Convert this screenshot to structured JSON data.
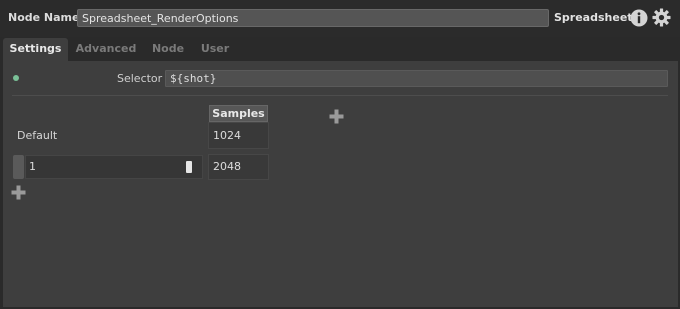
{
  "header": {
    "node_name_label": "Node Name",
    "node_name_value": "Spreadsheet_RenderOptions",
    "node_type": "Spreadsheet",
    "icons": [
      "info-icon",
      "gear-icon"
    ]
  },
  "tabs": [
    {
      "label": "Settings",
      "active": true
    },
    {
      "label": "Advanced",
      "active": false
    },
    {
      "label": "Node",
      "active": false
    },
    {
      "label": "User",
      "active": false
    }
  ],
  "settings": {
    "selector_label": "Selector",
    "selector_value": "${shot}",
    "status_color": "#7ac097",
    "table": {
      "columns": [
        "Samples"
      ],
      "default_label": "Default",
      "default_values": [
        "1024"
      ],
      "rows": [
        {
          "name": "1",
          "values": [
            "2048"
          ]
        }
      ]
    }
  }
}
